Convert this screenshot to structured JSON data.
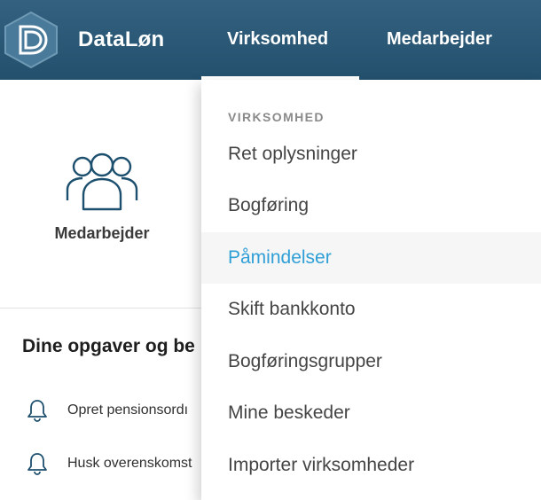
{
  "header": {
    "brand": "DataLøn",
    "nav": [
      {
        "label": "Virksomhed",
        "active": true
      },
      {
        "label": "Medarbejder",
        "active": false
      }
    ]
  },
  "quick_links": {
    "medarbejder_label": "Medarbejder"
  },
  "tasks": {
    "title": "Dine opgaver og be",
    "items": [
      {
        "text": "Opret pensionsordı"
      },
      {
        "text": "Husk overenskomst"
      }
    ]
  },
  "dropdown": {
    "heading": "VIRKSOMHED",
    "items": [
      {
        "label": "Ret oplysninger"
      },
      {
        "label": "Bogføring"
      },
      {
        "label": "Påmindelser",
        "active": true
      },
      {
        "label": "Skift bankkonto"
      },
      {
        "label": "Bogføringsgrupper"
      },
      {
        "label": "Mine beskeder"
      },
      {
        "label": "Importer virksomheder"
      }
    ]
  },
  "colors": {
    "header_bg": "#23506d",
    "active_link": "#2f9fd6",
    "icon_stroke": "#1d4f6e"
  }
}
